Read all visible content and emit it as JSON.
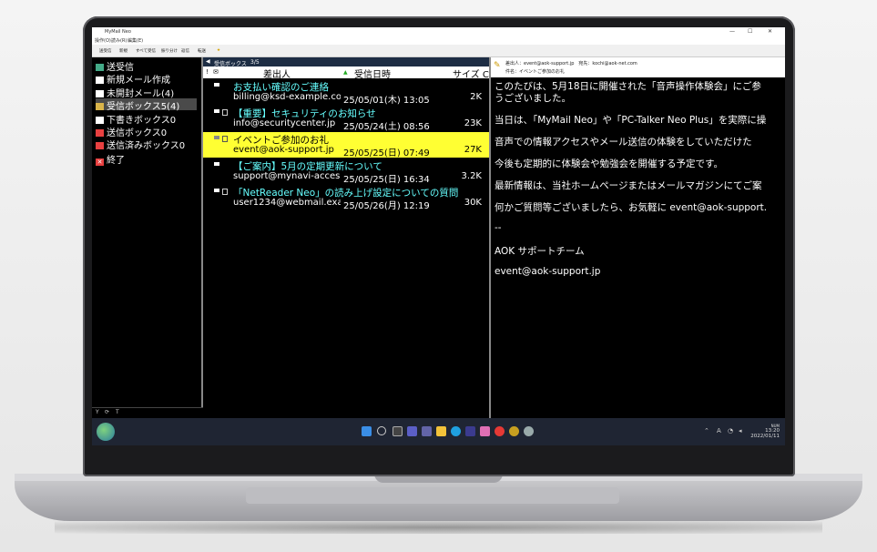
{
  "window": {
    "title": "MyMail Neo",
    "menu": [
      "操作(O)",
      "読み(R)",
      "編集(E)"
    ],
    "toolbar": [
      "送受信",
      "新規",
      "すべて受信",
      "振り分け",
      "返信",
      "転送"
    ]
  },
  "sidebar": {
    "items": [
      {
        "label": "送受信",
        "icon": "send-receive-icon",
        "color": "#ffffff"
      },
      {
        "label": "新規メール作成",
        "icon": "new-mail-icon",
        "color": "#ffffff"
      },
      {
        "label": "未開封メール(4)",
        "icon": "unread-mail-icon",
        "color": "#ffffff"
      },
      {
        "label": "受信ボックス5(4)",
        "icon": "inbox-icon",
        "color": "#d9b44a",
        "selected": true
      },
      {
        "label": "下書きボックス0",
        "icon": "drafts-icon",
        "color": "#ffffff"
      },
      {
        "label": "送信ボックス0",
        "icon": "outbox-icon",
        "color": "#e84040"
      },
      {
        "label": "送信済みボックス0",
        "icon": "sent-icon",
        "color": "#e84040"
      },
      {
        "label": "終了",
        "icon": "exit-icon",
        "color": "#e84040"
      }
    ]
  },
  "list": {
    "folder": "受信ボックス",
    "position": "3/5",
    "columns": {
      "from": "差出人",
      "date": "受信日時",
      "size": "サイズ C"
    },
    "messages": [
      {
        "subject": "お支払い確認のご連絡",
        "from": "billing@ksd-example.com",
        "date": "25/05/01(木) 13:05",
        "size": "2K"
      },
      {
        "subject": "【重要】セキュリティのお知らせ",
        "from": "info@securitycenter.jp",
        "date": "25/05/24(土) 08:56",
        "size": "23K"
      },
      {
        "subject": "イベントご参加のお礼",
        "from": "event@aok-support.jp",
        "date": "25/05/25(日) 07:49",
        "size": "27K",
        "selected": true
      },
      {
        "subject": "【ご案内】5月の定期更新について",
        "from": "support@mynavi-acces...",
        "date": "25/05/25(日) 16:34",
        "size": "3.2K"
      },
      {
        "subject": "「NetReader Neo」の読み上げ設定についての質問",
        "from": "user1234@webmail.exa...",
        "date": "25/05/26(月) 12:19",
        "size": "30K"
      }
    ]
  },
  "reader": {
    "header_from": "差出人：event@aok-support.jp　宛先：kochi@aok-net.com",
    "header_subject": "件名：イベントご参加のお礼",
    "lines": [
      "このたびは、5月18日に開催された「音声操作体験会」にご参",
      "うございました。",
      "",
      "当日は、「MyMail Neo」や「PC-Talker Neo Plus」を実際に操",
      "",
      "音声での情報アクセスやメール送信の体験をしていただけた",
      "",
      "今後も定期的に体験会や勉強会を開催する予定です。",
      "",
      "最新情報は、当社ホームページまたはメールマガジンにてご案",
      "",
      "何かご質問等ございましたら、お気軽に event@aok-support.",
      "",
      "--",
      "",
      "AOK サポートチーム",
      "",
      "event@aok-support.jp"
    ]
  },
  "taskbar": {
    "lang": "A",
    "ime": "NUM",
    "time": "13:20",
    "date": "2022/01/11"
  }
}
